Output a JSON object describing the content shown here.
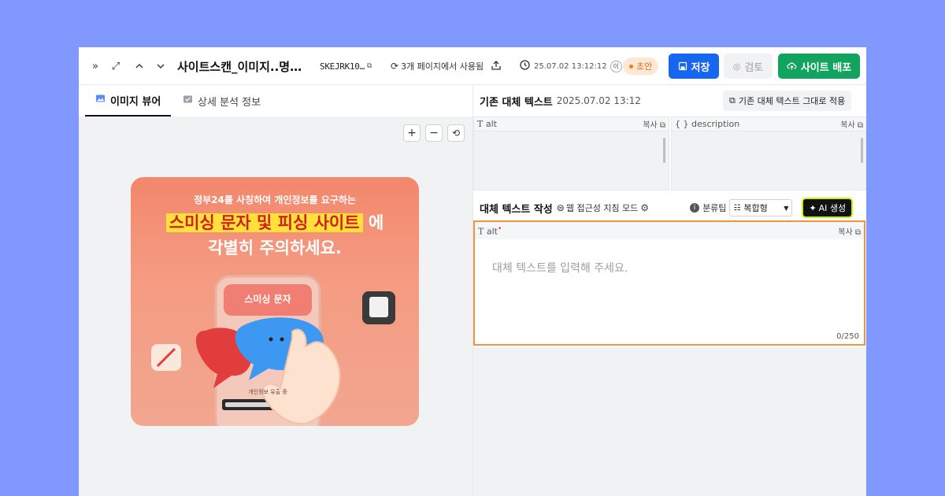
{
  "toolbar": {
    "title": "사이트스캔_이미지..명…",
    "doc_id": "SKEJRK10…",
    "usage": "3개 페이지에서 사용됨",
    "timestamp": "25.07.02 13:12:12",
    "user_initial": "이",
    "status": "초안",
    "save_label": "저장",
    "review_label": "검토",
    "deploy_label": "사이트 배포"
  },
  "left": {
    "tabs": [
      {
        "label": "이미지 뷰어"
      },
      {
        "label": "상세 분석 정보"
      }
    ],
    "preview": {
      "line1": "정부24를 사칭하여 개인정보를 요구하는",
      "line2_highlight": "스미싱 문자 및 피싱 사이트",
      "line2_tail": "에",
      "line3": "각별히 주의하세요.",
      "phone_label": "스미싱 문자",
      "progress_label": "개인정보 유출 중"
    }
  },
  "right": {
    "existing": {
      "title": "기존 대체 텍스트",
      "date": "2025.07.02 13:12",
      "apply_label": "기존 대체 텍스트 그대로 적용"
    },
    "fields": {
      "alt_label": "alt",
      "desc_label": "description",
      "copy_label": "복사"
    },
    "compose": {
      "title": "대체 텍스트 작성",
      "mode": "웹 접근성 지침 모드",
      "tip": "분류팁",
      "select_value": "복합형",
      "ai_label": "AI 생성",
      "alt_label": "alt",
      "copy_label": "복사",
      "placeholder": "대체 텍스트를 입력해 주세요.",
      "counter": "0/250"
    }
  },
  "colors": {
    "background": "#8198ff",
    "save": "#1766f0",
    "deploy": "#12a45f",
    "draft": "#e36a12",
    "editor_border": "#f2933f"
  }
}
